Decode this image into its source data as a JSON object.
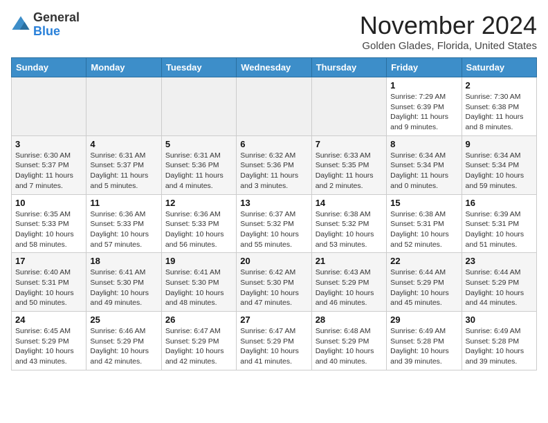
{
  "header": {
    "logo_general": "General",
    "logo_blue": "Blue",
    "month_title": "November 2024",
    "location": "Golden Glades, Florida, United States"
  },
  "calendar": {
    "days_of_week": [
      "Sunday",
      "Monday",
      "Tuesday",
      "Wednesday",
      "Thursday",
      "Friday",
      "Saturday"
    ],
    "weeks": [
      [
        {
          "day": "",
          "info": ""
        },
        {
          "day": "",
          "info": ""
        },
        {
          "day": "",
          "info": ""
        },
        {
          "day": "",
          "info": ""
        },
        {
          "day": "",
          "info": ""
        },
        {
          "day": "1",
          "info": "Sunrise: 7:29 AM\nSunset: 6:39 PM\nDaylight: 11 hours and 9 minutes."
        },
        {
          "day": "2",
          "info": "Sunrise: 7:30 AM\nSunset: 6:38 PM\nDaylight: 11 hours and 8 minutes."
        }
      ],
      [
        {
          "day": "3",
          "info": "Sunrise: 6:30 AM\nSunset: 5:37 PM\nDaylight: 11 hours and 7 minutes."
        },
        {
          "day": "4",
          "info": "Sunrise: 6:31 AM\nSunset: 5:37 PM\nDaylight: 11 hours and 5 minutes."
        },
        {
          "day": "5",
          "info": "Sunrise: 6:31 AM\nSunset: 5:36 PM\nDaylight: 11 hours and 4 minutes."
        },
        {
          "day": "6",
          "info": "Sunrise: 6:32 AM\nSunset: 5:36 PM\nDaylight: 11 hours and 3 minutes."
        },
        {
          "day": "7",
          "info": "Sunrise: 6:33 AM\nSunset: 5:35 PM\nDaylight: 11 hours and 2 minutes."
        },
        {
          "day": "8",
          "info": "Sunrise: 6:34 AM\nSunset: 5:34 PM\nDaylight: 11 hours and 0 minutes."
        },
        {
          "day": "9",
          "info": "Sunrise: 6:34 AM\nSunset: 5:34 PM\nDaylight: 10 hours and 59 minutes."
        }
      ],
      [
        {
          "day": "10",
          "info": "Sunrise: 6:35 AM\nSunset: 5:33 PM\nDaylight: 10 hours and 58 minutes."
        },
        {
          "day": "11",
          "info": "Sunrise: 6:36 AM\nSunset: 5:33 PM\nDaylight: 10 hours and 57 minutes."
        },
        {
          "day": "12",
          "info": "Sunrise: 6:36 AM\nSunset: 5:33 PM\nDaylight: 10 hours and 56 minutes."
        },
        {
          "day": "13",
          "info": "Sunrise: 6:37 AM\nSunset: 5:32 PM\nDaylight: 10 hours and 55 minutes."
        },
        {
          "day": "14",
          "info": "Sunrise: 6:38 AM\nSunset: 5:32 PM\nDaylight: 10 hours and 53 minutes."
        },
        {
          "day": "15",
          "info": "Sunrise: 6:38 AM\nSunset: 5:31 PM\nDaylight: 10 hours and 52 minutes."
        },
        {
          "day": "16",
          "info": "Sunrise: 6:39 AM\nSunset: 5:31 PM\nDaylight: 10 hours and 51 minutes."
        }
      ],
      [
        {
          "day": "17",
          "info": "Sunrise: 6:40 AM\nSunset: 5:31 PM\nDaylight: 10 hours and 50 minutes."
        },
        {
          "day": "18",
          "info": "Sunrise: 6:41 AM\nSunset: 5:30 PM\nDaylight: 10 hours and 49 minutes."
        },
        {
          "day": "19",
          "info": "Sunrise: 6:41 AM\nSunset: 5:30 PM\nDaylight: 10 hours and 48 minutes."
        },
        {
          "day": "20",
          "info": "Sunrise: 6:42 AM\nSunset: 5:30 PM\nDaylight: 10 hours and 47 minutes."
        },
        {
          "day": "21",
          "info": "Sunrise: 6:43 AM\nSunset: 5:29 PM\nDaylight: 10 hours and 46 minutes."
        },
        {
          "day": "22",
          "info": "Sunrise: 6:44 AM\nSunset: 5:29 PM\nDaylight: 10 hours and 45 minutes."
        },
        {
          "day": "23",
          "info": "Sunrise: 6:44 AM\nSunset: 5:29 PM\nDaylight: 10 hours and 44 minutes."
        }
      ],
      [
        {
          "day": "24",
          "info": "Sunrise: 6:45 AM\nSunset: 5:29 PM\nDaylight: 10 hours and 43 minutes."
        },
        {
          "day": "25",
          "info": "Sunrise: 6:46 AM\nSunset: 5:29 PM\nDaylight: 10 hours and 42 minutes."
        },
        {
          "day": "26",
          "info": "Sunrise: 6:47 AM\nSunset: 5:29 PM\nDaylight: 10 hours and 42 minutes."
        },
        {
          "day": "27",
          "info": "Sunrise: 6:47 AM\nSunset: 5:29 PM\nDaylight: 10 hours and 41 minutes."
        },
        {
          "day": "28",
          "info": "Sunrise: 6:48 AM\nSunset: 5:29 PM\nDaylight: 10 hours and 40 minutes."
        },
        {
          "day": "29",
          "info": "Sunrise: 6:49 AM\nSunset: 5:28 PM\nDaylight: 10 hours and 39 minutes."
        },
        {
          "day": "30",
          "info": "Sunrise: 6:49 AM\nSunset: 5:28 PM\nDaylight: 10 hours and 39 minutes."
        }
      ]
    ]
  }
}
